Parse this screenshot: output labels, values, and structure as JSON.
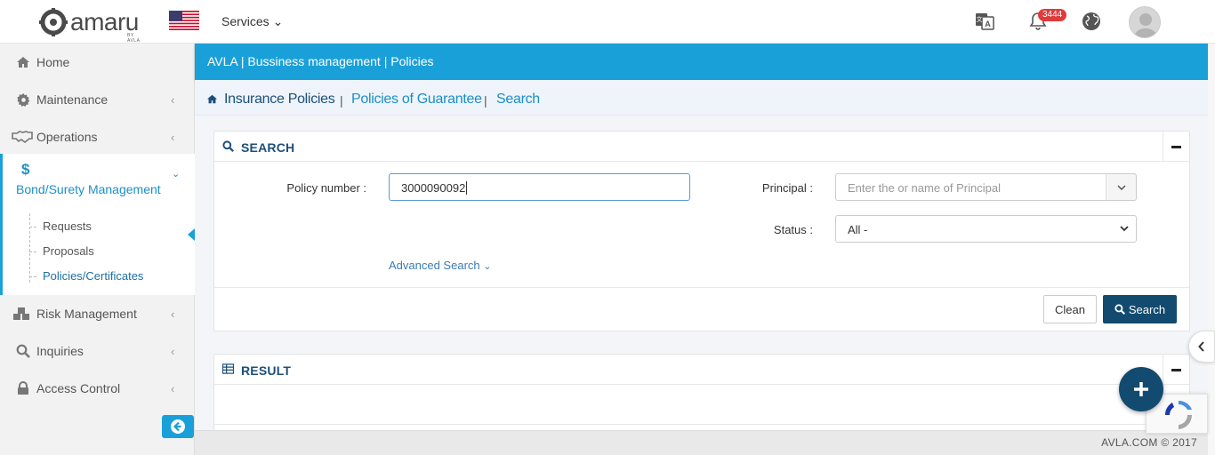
{
  "header": {
    "logo_text": "amaru",
    "logo_sub": "BY AVLA",
    "services_label": "Services ⌄",
    "notification_count": "3444"
  },
  "sidebar": {
    "items": [
      {
        "label": "Home",
        "icon": "home-icon"
      },
      {
        "label": "Maintenance",
        "icon": "gear-icon"
      },
      {
        "label": "Operations",
        "icon": "handshake-icon"
      },
      {
        "label": "Bond/Surety Management",
        "icon": "dollar-icon"
      },
      {
        "label": "Risk Management",
        "icon": "cubes-icon"
      },
      {
        "label": "Inquiries",
        "icon": "search-icon"
      },
      {
        "label": "Access Control",
        "icon": "lock-icon"
      }
    ],
    "bond_symbol": "$",
    "subitems": [
      "Requests",
      "Proposals",
      "Policies/Certificates"
    ],
    "active_subitem": "Policies/Certificates"
  },
  "topbar_path": "AVLA | Bussiness management | Policies",
  "breadcrumb": {
    "items": [
      "Insurance Policies",
      "Policies of Guarantee",
      "Search"
    ],
    "separator": "|"
  },
  "search_panel": {
    "title": "SEARCH",
    "policy_number_label": "Policy number :",
    "policy_number_value": "3000090092",
    "principal_label": "Principal :",
    "principal_placeholder": "Enter the or name of Principal",
    "status_label": "Status :",
    "status_value": "All -",
    "advanced_search": "Advanced Search",
    "clean_label": "Clean",
    "search_label": "Search"
  },
  "result_panel": {
    "title": "RESULT"
  },
  "footer": {
    "text": "AVLA.COM © 2017"
  },
  "colors": {
    "accent": "#1aa0d8",
    "primary_dark": "#134a6f",
    "badge": "#e03b3b"
  }
}
